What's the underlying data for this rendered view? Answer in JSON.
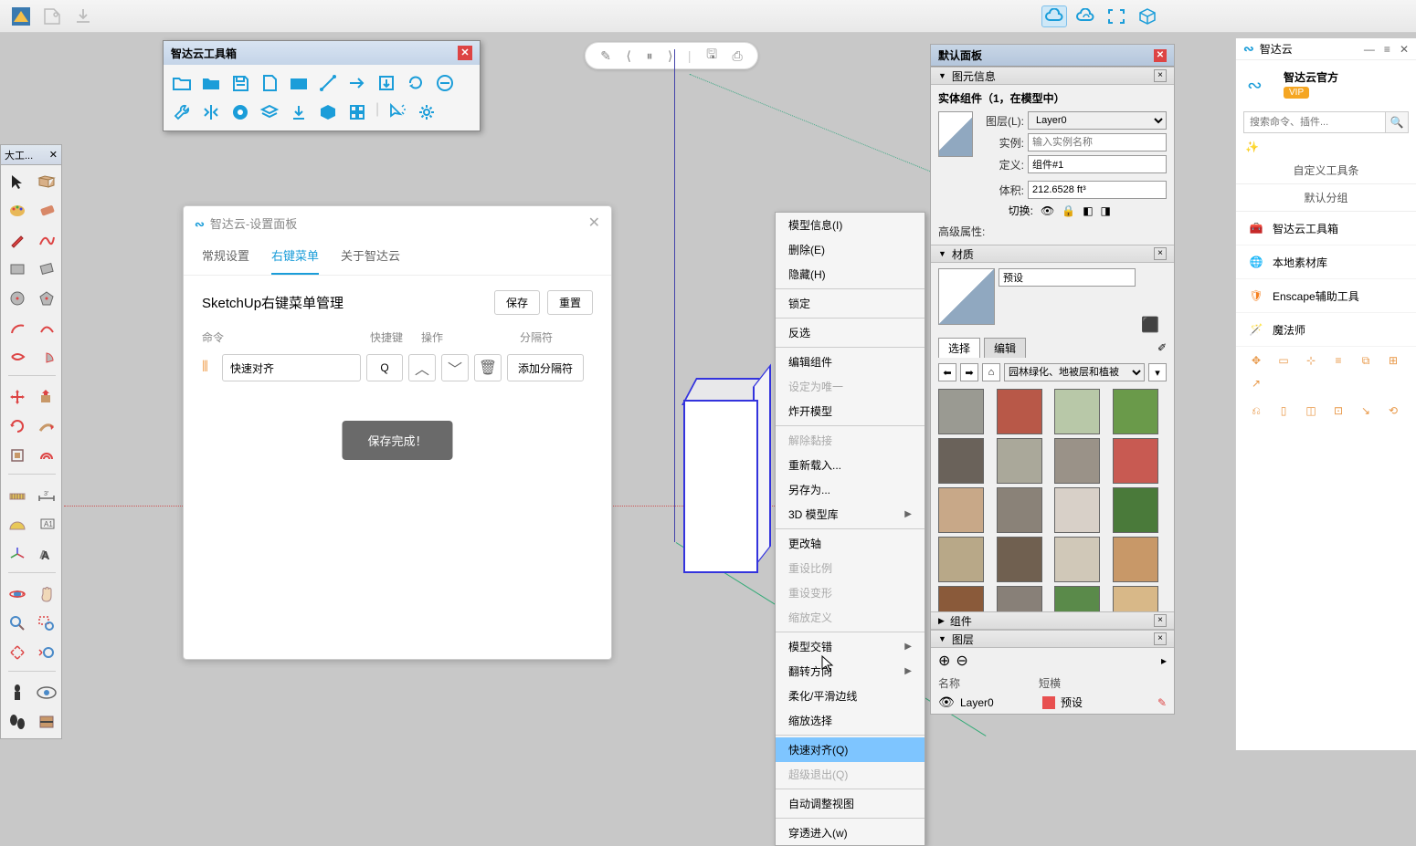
{
  "top_toolbox": {
    "title": "智达云工具箱"
  },
  "left_toolbar": {
    "title": "大工..."
  },
  "dialog": {
    "title": "智达云-设置面板",
    "tabs": [
      "常规设置",
      "右键菜单",
      "关于智达云"
    ],
    "heading": "SketchUp右键菜单管理",
    "save_btn": "保存",
    "reset_btn": "重置",
    "col_cmd": "命令",
    "col_key": "快捷键",
    "col_op": "操作",
    "col_sep": "分隔符",
    "cmd_name": "快速对齐",
    "cmd_key": "Q",
    "sep_btn": "添加分隔符",
    "toast": "保存完成！"
  },
  "context_menu": {
    "items": [
      {
        "label": "模型信息(I)",
        "disabled": false
      },
      {
        "label": "删除(E)",
        "disabled": false
      },
      {
        "label": "隐藏(H)",
        "disabled": false
      },
      {
        "divider": true
      },
      {
        "label": "锁定",
        "disabled": false
      },
      {
        "divider": true
      },
      {
        "label": "反选",
        "disabled": false
      },
      {
        "divider": true
      },
      {
        "label": "编辑组件",
        "disabled": false
      },
      {
        "label": "设定为唯一",
        "disabled": true
      },
      {
        "label": "炸开模型",
        "disabled": false
      },
      {
        "divider": true
      },
      {
        "label": "解除黏接",
        "disabled": true
      },
      {
        "label": "重新载入...",
        "disabled": false
      },
      {
        "label": "另存为...",
        "disabled": false
      },
      {
        "label": "3D 模型库",
        "sub": true
      },
      {
        "divider": true
      },
      {
        "label": "更改轴",
        "disabled": false
      },
      {
        "label": "重设比例",
        "disabled": true
      },
      {
        "label": "重设变形",
        "disabled": true
      },
      {
        "label": "缩放定义",
        "disabled": true
      },
      {
        "divider": true
      },
      {
        "label": "模型交错",
        "sub": true
      },
      {
        "label": "翻转方向",
        "sub": true
      },
      {
        "label": "柔化/平滑边线",
        "disabled": false
      },
      {
        "label": "缩放选择",
        "disabled": false
      },
      {
        "divider": true
      },
      {
        "label": "快速对齐(Q)",
        "highlight": true
      },
      {
        "label": "超级退出(Q)",
        "disabled": true
      },
      {
        "divider": true
      },
      {
        "label": "自动调整视图",
        "disabled": false
      },
      {
        "divider": true
      },
      {
        "label": "穿透进入(w)",
        "disabled": false
      }
    ]
  },
  "right": {
    "panel_title": "默认面板",
    "entity_hdr": "图元信息",
    "entity_title": "实体组件（1，在模型中）",
    "layer_lbl": "图层(L):",
    "layer_val": "Layer0",
    "instance_lbl": "实例:",
    "instance_ph": "输入实例名称",
    "def_lbl": "定义:",
    "def_val": "组件#1",
    "area_lbl": "体积:",
    "area_val": "212.6528 ft³",
    "switch_lbl": "切换:",
    "adv_attr": "高级属性:",
    "material_hdr": "材质",
    "mat_default": "预设",
    "tab_select": "选择",
    "tab_edit": "编辑",
    "mat_category": "园林绿化、地被层和植被",
    "components_hdr": "组件",
    "layers_hdr": "图层",
    "layer_name_hdr": "名称",
    "layer_dash_hdr": "短横",
    "layer0": "Layer0",
    "layer_dash": "预设"
  },
  "far_right": {
    "brand": "智达云",
    "user_name": "智达云官方",
    "vip": "VIP",
    "search_ph": "搜索命令、插件...",
    "tab1": "自定义工具条",
    "tab2": "默认分组",
    "items": [
      "智达云工具箱",
      "本地素材库",
      "Enscape辅助工具",
      "魔法师"
    ]
  },
  "material_swatches": [
    "#9a9a92",
    "#b85848",
    "#b8c8a8",
    "#6a9a4a",
    "#6a625a",
    "#aaa89a",
    "#9a9288",
    "#c85a52",
    "#c8a888",
    "#8a8278",
    "#d8d0c8",
    "#4a7a3a",
    "#b8a888",
    "#706050",
    "#d0c8b8",
    "#c89868",
    "#8a5a3a",
    "#888078",
    "#5a8a4a",
    "#d8b888"
  ]
}
